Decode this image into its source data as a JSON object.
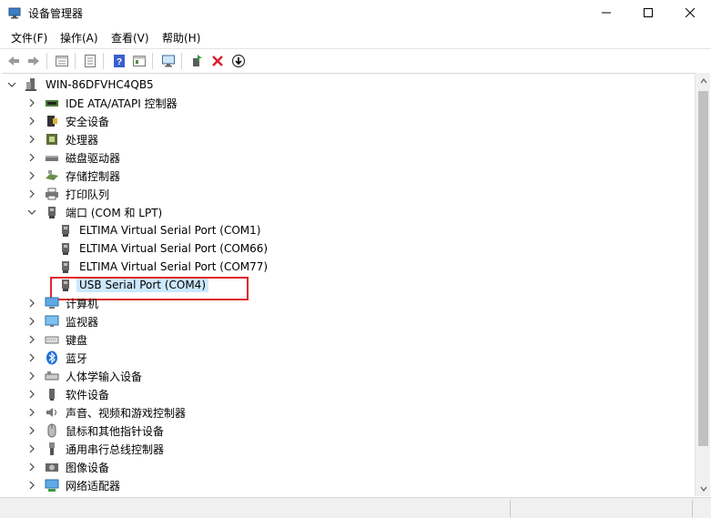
{
  "window": {
    "title": "设备管理器",
    "minimize_glyph": "—",
    "maximize_glyph": "☐",
    "close_glyph": "✕"
  },
  "menu": [
    {
      "label": "文件(F)"
    },
    {
      "label": "操作(A)"
    },
    {
      "label": "查看(V)"
    },
    {
      "label": "帮助(H)"
    }
  ],
  "toolbar": {
    "buttons": [
      "back-icon",
      "forward-icon",
      "properties-pane-icon",
      "device-list-icon",
      "help-icon",
      "view-resources-icon",
      "scan-hardware-icon",
      "update-driver-icon",
      "uninstall-icon",
      "disable-download-icon"
    ],
    "uninstall_color": "#d9232e",
    "help_color": "#3a5fcd"
  },
  "tree": {
    "root": "WIN-86DFVHC4QB5",
    "categories": [
      {
        "label": "IDE ATA/ATAPI 控制器",
        "icon": "ide-controller-icon"
      },
      {
        "label": "安全设备",
        "icon": "security-device-icon"
      },
      {
        "label": "处理器",
        "icon": "processor-icon"
      },
      {
        "label": "磁盘驱动器",
        "icon": "disk-drive-icon"
      },
      {
        "label": "存储控制器",
        "icon": "storage-controller-icon"
      },
      {
        "label": "打印队列",
        "icon": "printer-icon"
      },
      {
        "label": "端口 (COM 和 LPT)",
        "icon": "port-icon",
        "expanded": true,
        "children": [
          {
            "label": "ELTIMA Virtual Serial Port (COM1)"
          },
          {
            "label": "ELTIMA Virtual Serial Port (COM66)"
          },
          {
            "label": "ELTIMA Virtual Serial Port (COM77)"
          },
          {
            "label": "USB Serial Port (COM4)",
            "selected": true
          }
        ]
      },
      {
        "label": "计算机",
        "icon": "computer-icon"
      },
      {
        "label": "监视器",
        "icon": "monitor-icon"
      },
      {
        "label": "键盘",
        "icon": "keyboard-icon"
      },
      {
        "label": "蓝牙",
        "icon": "bluetooth-icon"
      },
      {
        "label": "人体学输入设备",
        "icon": "hid-icon"
      },
      {
        "label": "软件设备",
        "icon": "software-device-icon"
      },
      {
        "label": "声音、视频和游戏控制器",
        "icon": "audio-icon"
      },
      {
        "label": "鼠标和其他指针设备",
        "icon": "mouse-icon"
      },
      {
        "label": "通用串行总线控制器",
        "icon": "usb-controller-icon"
      },
      {
        "label": "图像设备",
        "icon": "camera-icon"
      },
      {
        "label": "网络适配器",
        "icon": "network-adapter-icon"
      }
    ]
  },
  "colors": {
    "selection": "#cce8ff",
    "highlight_border": "#e0262c",
    "bluetooth": "#1e6fd9"
  }
}
